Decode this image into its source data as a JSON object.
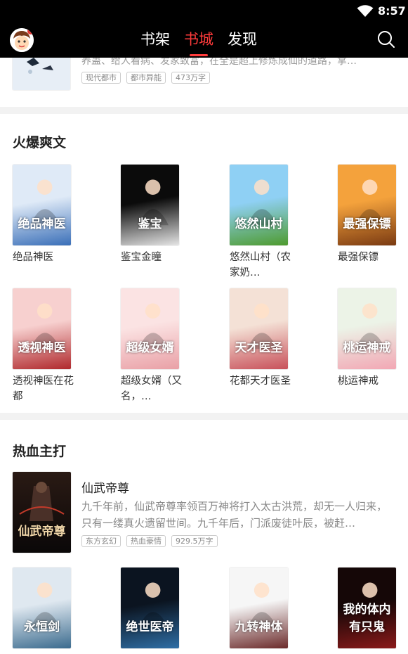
{
  "status": {
    "time": "8:57"
  },
  "header": {
    "tabs": [
      {
        "label": "书架"
      },
      {
        "label": "书城"
      },
      {
        "label": "发现"
      }
    ],
    "active_tab": "书城"
  },
  "top_book": {
    "desc": "养蛊、给人看病、发家致富，在全是超上修炼成仙的道路，掌…",
    "tags": [
      "现代都市",
      "都市异能",
      "473万字"
    ]
  },
  "hot_section": {
    "title": "火爆爽文",
    "books": [
      {
        "title": "绝品神医",
        "cover_text": "绝品神医",
        "color_a": "#dfeaf7",
        "color_b": "#3a6fb8"
      },
      {
        "title": "鉴宝金瞳",
        "cover_text": "鉴宝",
        "color_a": "#0b0b0b",
        "color_b": "#e6e6e6"
      },
      {
        "title": "悠然山村（农家奶…",
        "cover_text": "悠然山村",
        "color_a": "#8fd0f4",
        "color_b": "#4e9b2e"
      },
      {
        "title": "最强保镖",
        "cover_text": "最强保镖",
        "color_a": "#f4a23c",
        "color_b": "#7a3a12"
      },
      {
        "title": "透视神医在花都",
        "cover_text": "透视神医",
        "color_a": "#f7d0cf",
        "color_b": "#b0282c"
      },
      {
        "title": "超级女婿（又名，…",
        "cover_text": "超级女婿",
        "color_a": "#fbe3e3",
        "color_b": "#e9a0a6"
      },
      {
        "title": "花都天才医圣",
        "cover_text": "天才医圣",
        "color_a": "#f4e1d6",
        "color_b": "#c8515a"
      },
      {
        "title": "桃运神戒",
        "cover_text": "桃运神戒",
        "color_a": "#ecf3e7",
        "color_b": "#f2a7b4"
      }
    ]
  },
  "blood_section": {
    "title": "热血主打",
    "feature": {
      "title": "仙武帝尊",
      "desc": "九千年前，仙武帝尊率领百万神将打入太古洪荒，却无一人归来，只有一缕真火遗留世间。九千年后，门派废徒叶辰，被赶…",
      "tags": [
        "东方玄幻",
        "热血豪情",
        "929.5万字"
      ],
      "cover_text": "仙武帝尊"
    },
    "books": [
      {
        "cover_text": "永恒剑",
        "color_a": "#dfe8f0",
        "color_b": "#3b6b8e"
      },
      {
        "cover_text": "绝世医帝",
        "color_a": "#0b1420",
        "color_b": "#2f6ea5"
      },
      {
        "cover_text": "九转神体",
        "color_a": "#f6f6f6",
        "color_b": "#6b2a2a"
      },
      {
        "cover_text": "我的体内有只鬼",
        "color_a": "#150707",
        "color_b": "#8a1a1a"
      }
    ]
  }
}
